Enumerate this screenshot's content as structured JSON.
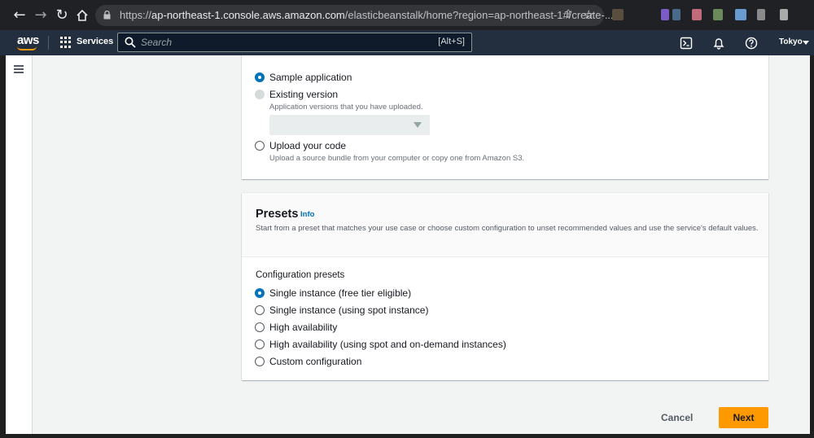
{
  "browser": {
    "url_scheme": "https://",
    "url_host": "ap-northeast-1.console.aws.amazon.com",
    "url_path": "/elasticbeanstalk/home?region=ap-northeast-1#/create-..."
  },
  "header": {
    "logo": "aws",
    "services_label": "Services",
    "search_placeholder": "Search",
    "search_shortcut": "[Alt+S]",
    "region": "Tokyo",
    "accent_color": "#ff9900",
    "bg_color": "#232f3e"
  },
  "application_code": {
    "options": [
      {
        "label": "Sample application",
        "state": "selected"
      },
      {
        "label": "Existing version",
        "description": "Application versions that you have uploaded.",
        "state": "disabled"
      },
      {
        "label": "Upload your code",
        "description": "Upload a source bundle from your computer or copy one from Amazon S3.",
        "state": "unselected"
      }
    ]
  },
  "presets": {
    "title": "Presets",
    "info_link": "Info",
    "description": "Start from a preset that matches your use case or choose custom configuration to unset recommended values and use the service's default values.",
    "field_label": "Configuration presets",
    "options": [
      {
        "label": "Single instance (free tier eligible)",
        "state": "selected"
      },
      {
        "label": "Single instance (using spot instance)",
        "state": "unselected"
      },
      {
        "label": "High availability",
        "state": "unselected"
      },
      {
        "label": "High availability (using spot and on-demand instances)",
        "state": "unselected"
      },
      {
        "label": "Custom configuration",
        "state": "unselected"
      }
    ]
  },
  "footer": {
    "cancel_label": "Cancel",
    "next_label": "Next",
    "primary_color": "#ff9900"
  }
}
